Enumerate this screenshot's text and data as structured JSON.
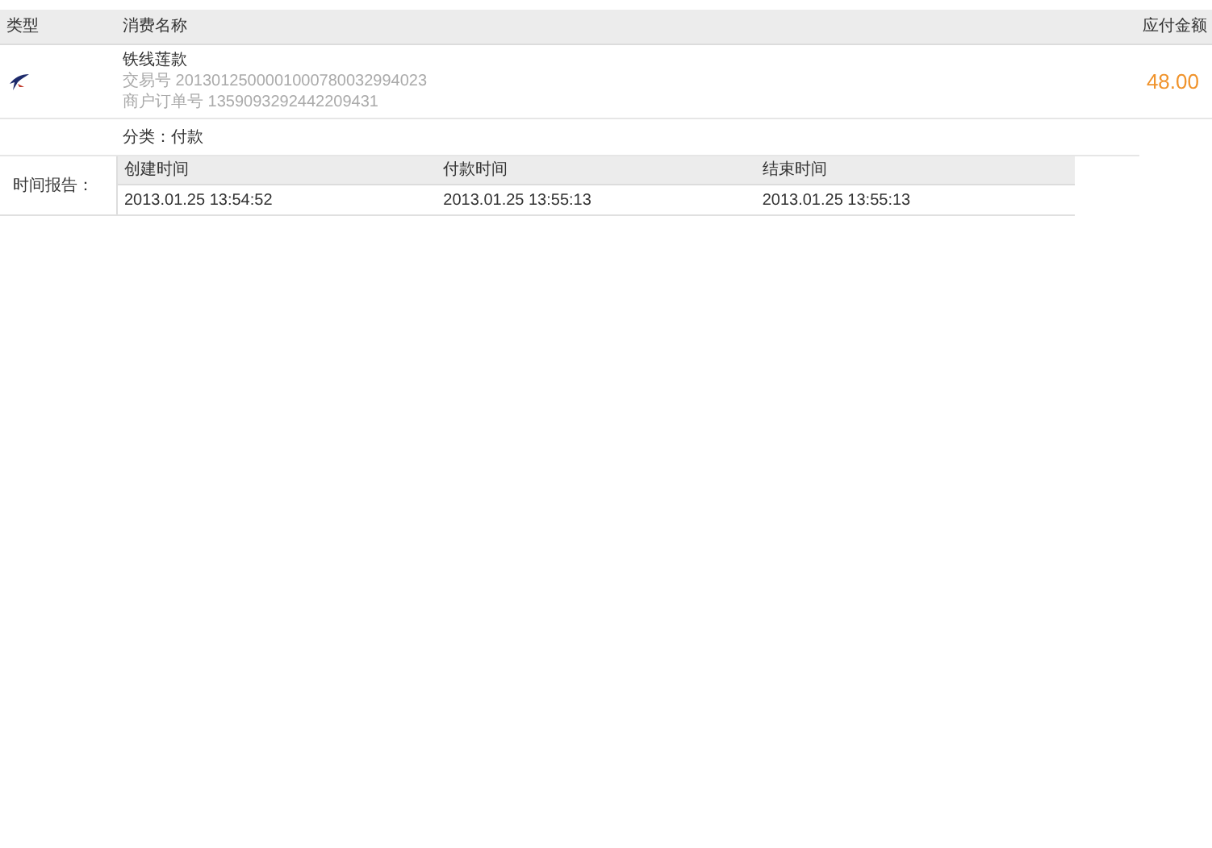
{
  "table_header": {
    "type": "类型",
    "name": "消费名称",
    "amount": "应付金额"
  },
  "record": {
    "title": "铁线莲款",
    "trade_no": "交易号 2013012500001000780032994023",
    "order_no": "商户订单号 1359093292442209431",
    "amount": "48.00",
    "category": "分类：付款"
  },
  "time_report": {
    "label": "时间报告：",
    "columns": [
      "创建时间",
      "付款时间",
      "结束时间"
    ],
    "values": [
      "2013.01.25 13:54:52",
      "2013.01.25 13:55:13",
      "2013.01.25 13:55:13"
    ]
  }
}
